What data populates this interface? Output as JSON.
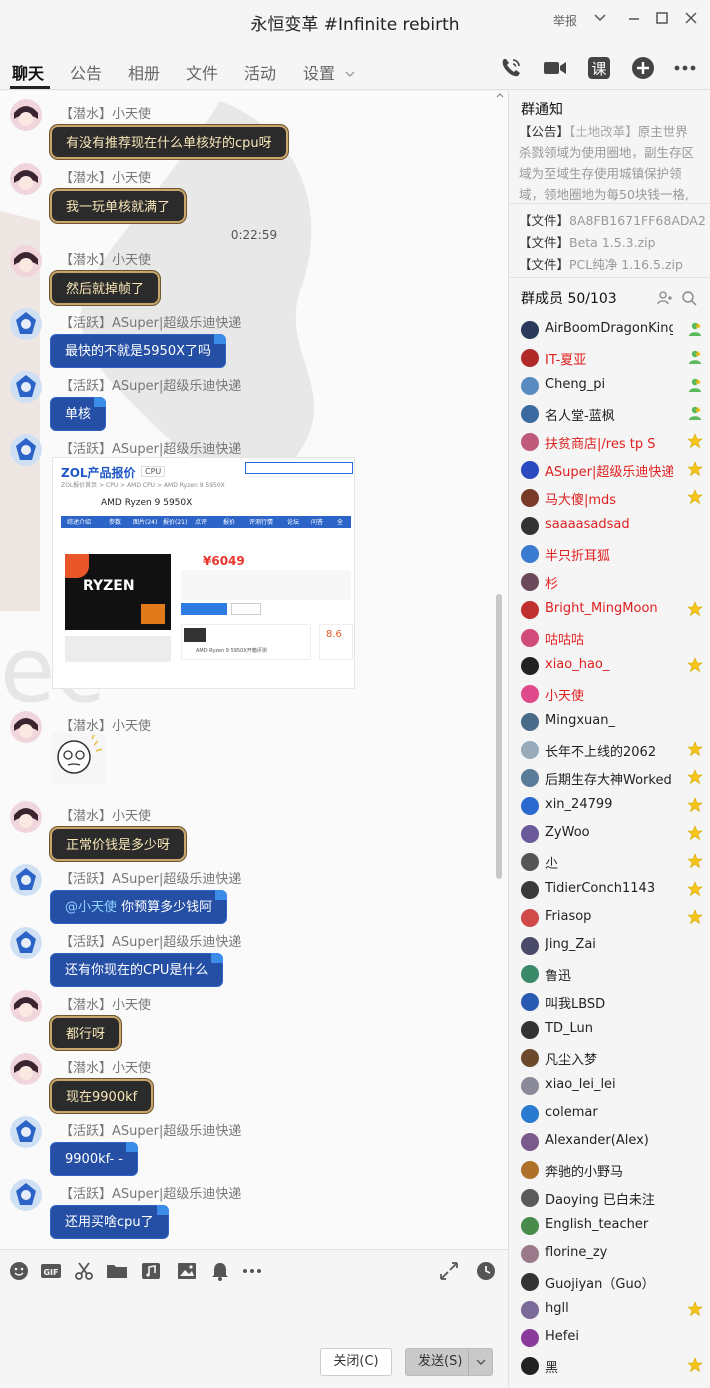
{
  "window": {
    "title": "永恒变革 #Infinite rebirth",
    "report_label": "举报"
  },
  "tabs": [
    {
      "label": "聊天"
    },
    {
      "label": "公告"
    },
    {
      "label": "相册"
    },
    {
      "label": "文件"
    },
    {
      "label": "活动"
    },
    {
      "label": "设置"
    }
  ],
  "header_icons": [
    "phone-icon",
    "video-icon",
    "lesson-icon",
    "add-app-icon",
    "more-icon"
  ],
  "chat": {
    "timestamp": "0:22:59",
    "messages": [
      {
        "sender": "【潜水】小天使",
        "text": "有没有推荐现在什么单核好的cpu呀",
        "style": "dark"
      },
      {
        "sender": "【潜水】小天使",
        "text": "我一玩单核就满了",
        "style": "dark"
      },
      {
        "sender": "【潜水】小天使",
        "text": "然后就掉帧了",
        "style": "dark"
      },
      {
        "sender": "【活跃】ASuper|超级乐迪快递",
        "text": "最快的不就是5950X了吗",
        "style": "blue"
      },
      {
        "sender": "【活跃】ASuper|超级乐迪快递",
        "text": "单核",
        "style": "blue"
      },
      {
        "sender": "【活跃】ASuper|超级乐迪快递",
        "text": "",
        "style": "image"
      },
      {
        "sender": "【潜水】小天使",
        "text": "",
        "style": "sticker"
      },
      {
        "sender": "【潜水】小天使",
        "text": "正常价钱是多少呀",
        "style": "dark"
      },
      {
        "sender": "【活跃】ASuper|超级乐迪快递",
        "mention": "@小天使",
        "text": " 你预算多少钱阿",
        "style": "blue"
      },
      {
        "sender": "【活跃】ASuper|超级乐迪快递",
        "text": "还有你现在的CPU是什么",
        "style": "blue"
      },
      {
        "sender": "【潜水】小天使",
        "text": "都行呀",
        "style": "dark"
      },
      {
        "sender": "【潜水】小天使",
        "text": "现在9900kf",
        "style": "dark"
      },
      {
        "sender": "【活跃】ASuper|超级乐迪快递",
        "text": "9900kf- -",
        "style": "blue"
      },
      {
        "sender": "【活跃】ASuper|超级乐迪快递",
        "text": "还用买啥cpu了",
        "style": "blue"
      }
    ]
  },
  "product_shot": {
    "site": "ZOL产品报价",
    "category": "CPU",
    "breadcrumb": "ZOL报价首页 > CPU > AMD CPU > AMD Ryzen 9 5950X",
    "product": "AMD Ryzen 9 5950X",
    "tabs": [
      "综述介绍",
      "参数",
      "图片(24)",
      "报价(21)",
      "点评",
      "报价",
      "评测行情",
      "论坛",
      "问答",
      "全"
    ],
    "price": "¥6049",
    "score": "8.6",
    "brand": "RYZEN",
    "news": "AMD Ryzen 9 5950X开箱评测"
  },
  "input_toolbar": {
    "icons": [
      "emoji-icon",
      "gif-icon",
      "scissors-icon",
      "folder-icon",
      "music-icon",
      "image-icon",
      "bell-icon",
      "more-icon"
    ],
    "close_label": "关闭(C)",
    "send_label": "发送(S)"
  },
  "notice": {
    "title": "群通知",
    "tag": "【公告】",
    "highlight": "【土地改革】",
    "text": "原主世界杀戮领域为使用圈地，副生存区域为至域生存使用城镇保护领域，领地圈地为每50块钱一格,"
  },
  "files": [
    {
      "tag": "【文件】",
      "name": "8A8FB1671FF68ADA2..."
    },
    {
      "tag": "【文件】",
      "name": "Beta 1.5.3.zip"
    },
    {
      "tag": "【文件】",
      "name": "PCL纯净 1.16.5.zip"
    }
  ],
  "members": {
    "title": "群成员 50/103",
    "list": [
      {
        "name": "AirBoomDragonKing",
        "color": "dark",
        "badge": "admin"
      },
      {
        "name": "IT-夏亚",
        "color": "red",
        "badge": "admin"
      },
      {
        "name": "Cheng_pi",
        "color": "dark",
        "badge": "admin"
      },
      {
        "name": "名人堂-蓝枫",
        "color": "dark",
        "badge": "admin"
      },
      {
        "name": "扶贫商店|/res tp S",
        "color": "red",
        "badge": "star"
      },
      {
        "name": "ASuper|超级乐迪快递",
        "color": "red",
        "badge": "star"
      },
      {
        "name": "马大傻|mds",
        "color": "red",
        "badge": "star"
      },
      {
        "name": "saaaasadsad",
        "color": "red",
        "badge": ""
      },
      {
        "name": "半只折耳狐",
        "color": "red",
        "badge": ""
      },
      {
        "name": "杉",
        "color": "red",
        "badge": ""
      },
      {
        "name": "Bright_MingMoon",
        "color": "red",
        "badge": "star"
      },
      {
        "name": "咕咕咕",
        "color": "red",
        "badge": ""
      },
      {
        "name": "xiao_hao_",
        "color": "red",
        "badge": "star"
      },
      {
        "name": "小天使",
        "color": "red",
        "badge": ""
      },
      {
        "name": "Mingxuan_",
        "color": "dark",
        "badge": ""
      },
      {
        "name": "长年不上线的2062",
        "color": "dark",
        "badge": "star"
      },
      {
        "name": "后期生存大神Worked",
        "color": "dark",
        "badge": "star"
      },
      {
        "name": "xin_24799",
        "color": "dark",
        "badge": "star"
      },
      {
        "name": "ZyWoo",
        "color": "dark",
        "badge": "star"
      },
      {
        "name": "尐",
        "color": "dark",
        "badge": "star"
      },
      {
        "name": "TidierConch1143",
        "color": "dark",
        "badge": "star"
      },
      {
        "name": "Friasop",
        "color": "dark",
        "badge": "star"
      },
      {
        "name": "Jing_Zai",
        "color": "dark",
        "badge": ""
      },
      {
        "name": "鲁迅",
        "color": "dark",
        "badge": ""
      },
      {
        "name": "叫我LBSD",
        "color": "dark",
        "badge": ""
      },
      {
        "name": "TD_Lun",
        "color": "dark",
        "badge": ""
      },
      {
        "name": "凡尘入梦",
        "color": "dark",
        "badge": ""
      },
      {
        "name": "xiao_lei_lei",
        "color": "dark",
        "badge": ""
      },
      {
        "name": "colemar",
        "color": "dark",
        "badge": ""
      },
      {
        "name": "Alexander(Alex)",
        "color": "dark",
        "badge": ""
      },
      {
        "name": "奔驰的小野马",
        "color": "dark",
        "badge": ""
      },
      {
        "name": "Daoying 已白未注",
        "color": "dark",
        "badge": ""
      },
      {
        "name": "English_teacher",
        "color": "dark",
        "badge": ""
      },
      {
        "name": "florine_zy",
        "color": "dark",
        "badge": ""
      },
      {
        "name": "Guojiyan（Guo）",
        "color": "dark",
        "badge": ""
      },
      {
        "name": "hgll",
        "color": "dark",
        "badge": "star"
      },
      {
        "name": "Hefei",
        "color": "dark",
        "badge": ""
      },
      {
        "name": "黑",
        "color": "dark",
        "badge": "star"
      }
    ]
  },
  "colors": {
    "accent_red": "#e02020",
    "bubble_blue": "#244fa5",
    "bubble_dark": "#2b2b2b",
    "gold_trim": "#c9a66b"
  }
}
